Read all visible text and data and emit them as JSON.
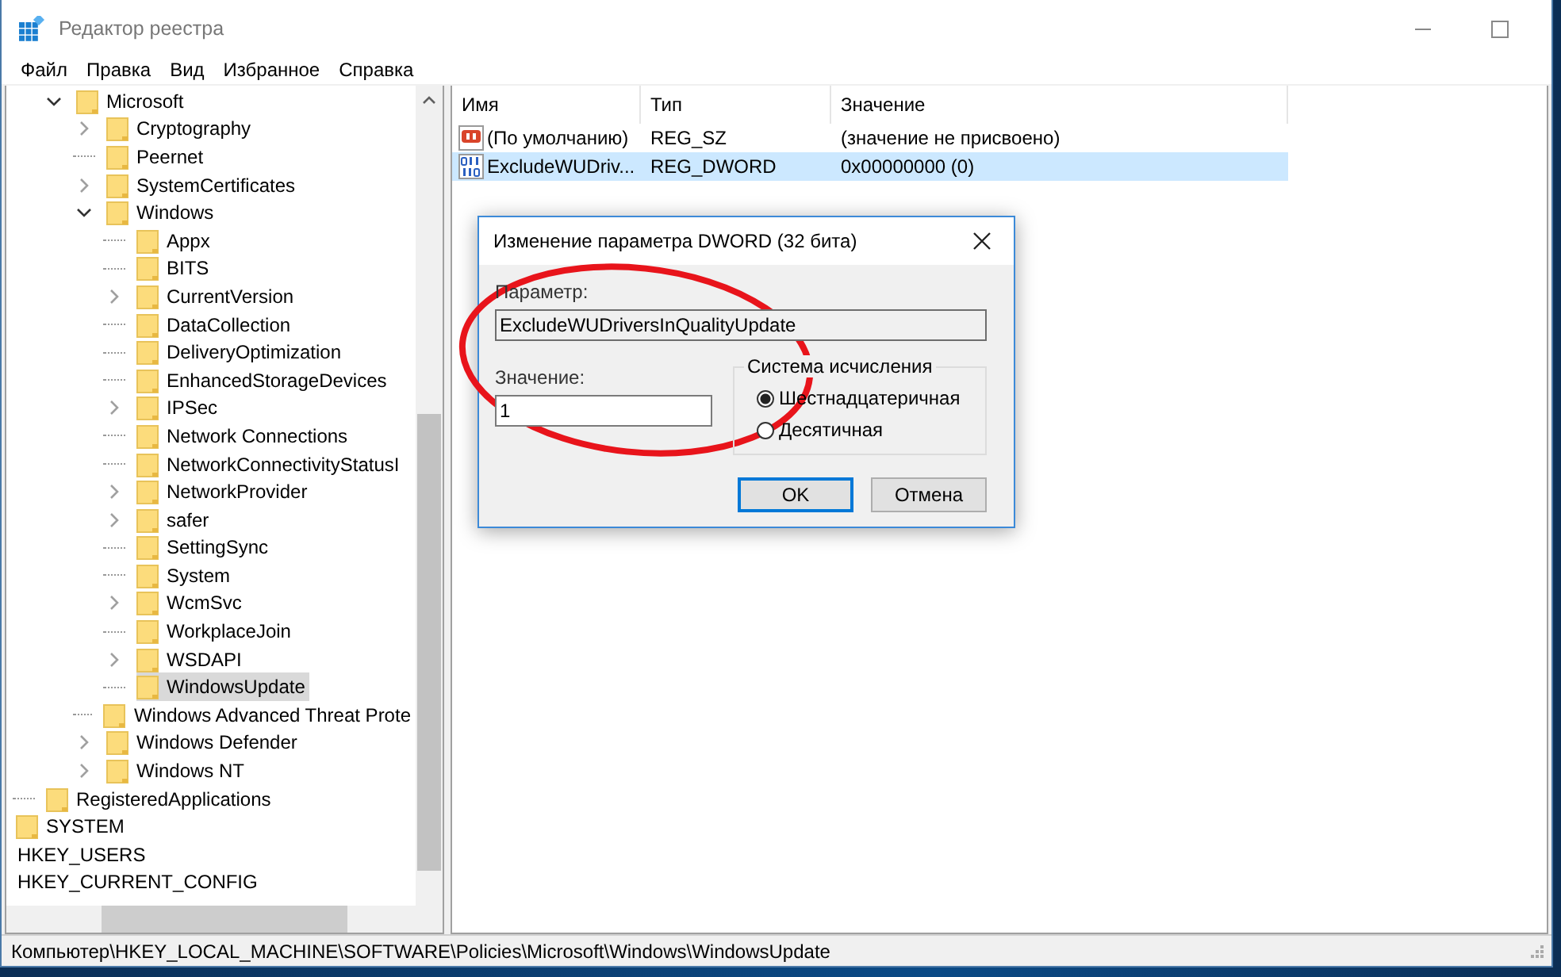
{
  "window": {
    "title": "Редактор реестра"
  },
  "menu": [
    "Файл",
    "Правка",
    "Вид",
    "Избранное",
    "Справка"
  ],
  "tree": {
    "items": [
      {
        "children": [
          {
            "children": [
              {
                "children": [
                  {
                    "label": "Microsoft",
                    "selected": false,
                    "expanded": true,
                    "children": [
                      {
                        "label": "Cryptography",
                        "selected": false,
                        "expanded": false
                      },
                      {
                        "label": "Peernet",
                        "selected": false
                      },
                      {
                        "label": "SystemCertificates",
                        "selected": false,
                        "expanded": false
                      },
                      {
                        "label": "Windows",
                        "selected": false,
                        "expanded": true,
                        "children": [
                          {
                            "label": "Appx",
                            "selected": false
                          },
                          {
                            "label": "BITS",
                            "selected": false
                          },
                          {
                            "label": "CurrentVersion",
                            "selected": false,
                            "expanded": false
                          },
                          {
                            "label": "DataCollection",
                            "selected": false
                          },
                          {
                            "label": "DeliveryOptimization",
                            "selected": false
                          },
                          {
                            "label": "EnhancedStorageDevices",
                            "selected": false
                          },
                          {
                            "label": "IPSec",
                            "selected": false,
                            "expanded": false
                          },
                          {
                            "label": "Network Connections",
                            "selected": false
                          },
                          {
                            "label": "NetworkConnectivityStatusI",
                            "selected": false
                          },
                          {
                            "label": "NetworkProvider",
                            "selected": false,
                            "expanded": false
                          },
                          {
                            "label": "safer",
                            "selected": false,
                            "expanded": false
                          },
                          {
                            "label": "SettingSync",
                            "selected": false
                          },
                          {
                            "label": "System",
                            "selected": false
                          },
                          {
                            "label": "WcmSvc",
                            "selected": false,
                            "expanded": false
                          },
                          {
                            "label": "WorkplaceJoin",
                            "selected": false
                          },
                          {
                            "label": "WSDAPI",
                            "selected": false,
                            "expanded": false
                          },
                          {
                            "label": "WindowsUpdate",
                            "selected": true
                          }
                        ]
                      },
                      {
                        "label": "Windows Advanced Threat Prote",
                        "selected": false
                      },
                      {
                        "label": "Windows Defender",
                        "selected": false,
                        "expanded": false
                      },
                      {
                        "label": "Windows NT",
                        "selected": false,
                        "expanded": false
                      }
                    ]
                  }
                ]
              },
              {
                "label": "RegisteredApplications",
                "selected": false
              }
            ]
          },
          {
            "label": "SYSTEM",
            "selected": false
          }
        ]
      },
      {
        "label": "HKEY_USERS",
        "selected": false
      },
      {
        "label": "HKEY_CURRENT_CONFIG",
        "selected": false
      }
    ]
  },
  "list": {
    "columns": [
      "Имя",
      "Тип",
      "Значение"
    ],
    "rows": [
      {
        "kind": "string",
        "name": "(По умолчанию)",
        "type": "REG_SZ",
        "value": "(значение не присвоено)",
        "selected": false
      },
      {
        "kind": "binary",
        "name": "ExcludeWUDriv...",
        "type": "REG_DWORD",
        "value": "0x00000000 (0)",
        "selected": true
      }
    ]
  },
  "dialog": {
    "title": "Изменение параметра DWORD (32 бита)",
    "param_label": "Параметр:",
    "param_value": "ExcludeWUDriversInQualityUpdate",
    "value_label": "Значение:",
    "value": "1",
    "base_group": "Система исчисления",
    "bases": [
      {
        "label": "Шестнадцатеричная",
        "selected": true
      },
      {
        "label": "Десятичная",
        "selected": false
      }
    ],
    "buttons": [
      {
        "label": "OK",
        "default": true
      },
      {
        "label": "Отмена",
        "default": false
      }
    ]
  },
  "status_bar": "Компьютер\\HKEY_LOCAL_MACHINE\\SOFTWARE\\Policies\\Microsoft\\Windows\\WindowsUpdate"
}
